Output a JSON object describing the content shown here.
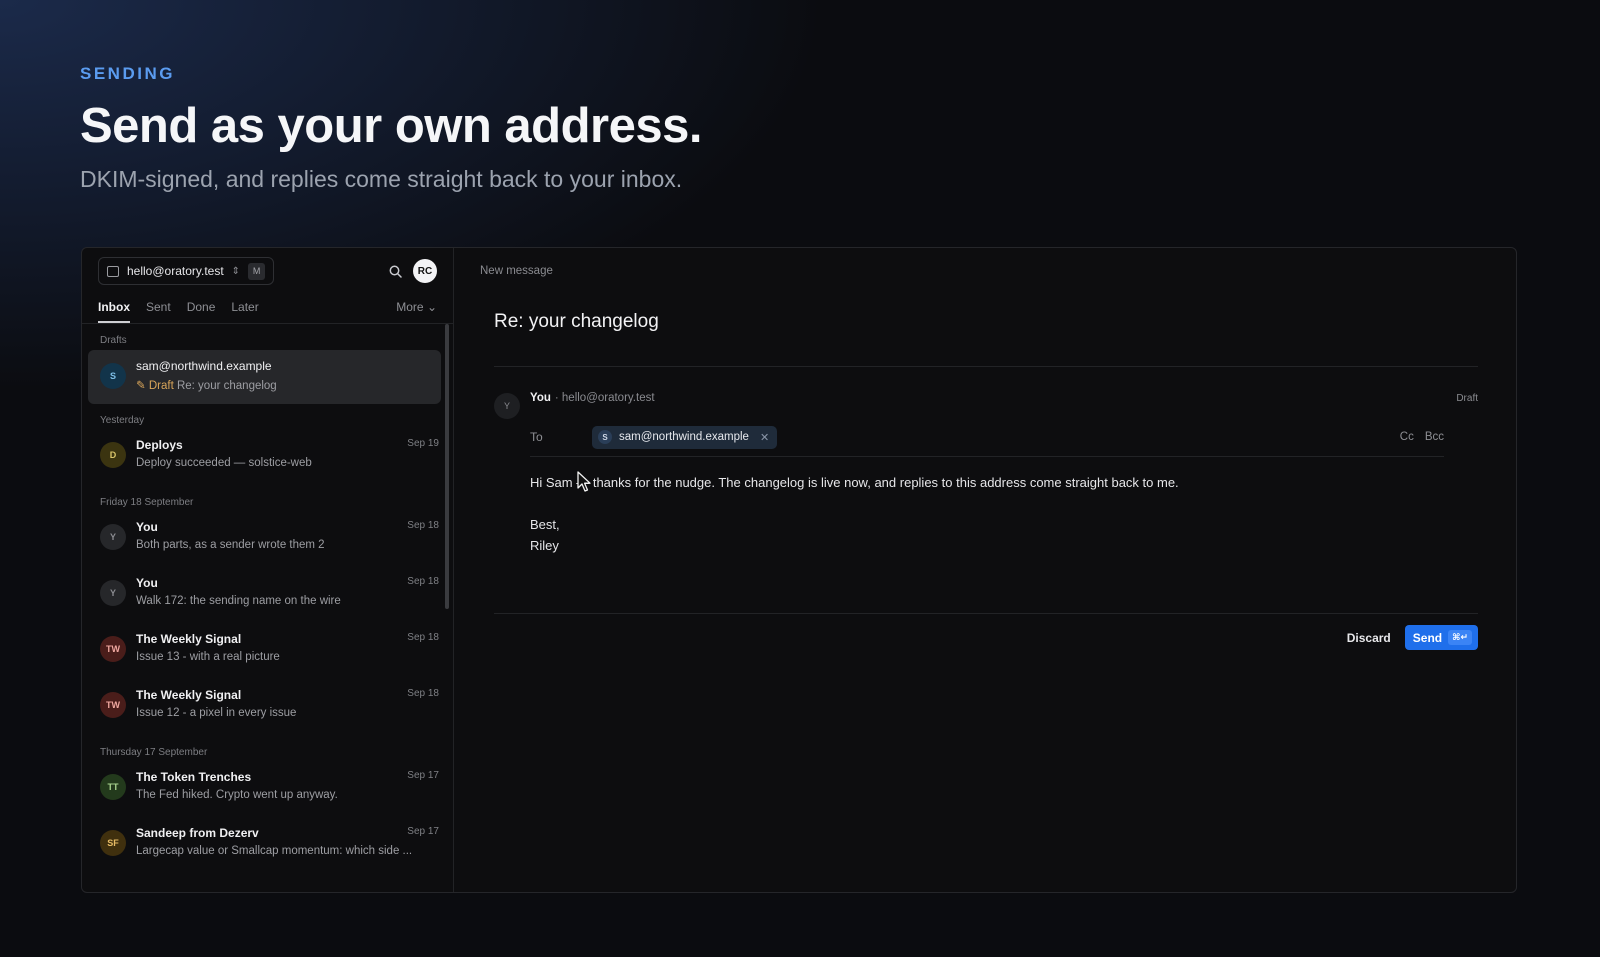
{
  "hero": {
    "eyebrow": "SENDING",
    "headline": "Send as your own address.",
    "subline": "DKIM-signed, and replies come straight back to your inbox."
  },
  "sidebar": {
    "account": "hello@oratory.test",
    "account_shortcut": "M",
    "user_initials": "RC",
    "tabs": [
      "Inbox",
      "Sent",
      "Done",
      "Later"
    ],
    "more_label": "More",
    "groups": [
      {
        "label": "Drafts",
        "items": [
          {
            "initial": "S",
            "from": "sam@northwind.example",
            "draft_label": "Draft",
            "snippet": "Re: your changelog",
            "date": ""
          }
        ]
      },
      {
        "label": "Yesterday",
        "items": [
          {
            "initial": "D",
            "from": "Deploys",
            "snippet": "Deploy succeeded — solstice-web",
            "date": "Sep 19"
          }
        ]
      },
      {
        "label": "Friday 18 September",
        "items": [
          {
            "initial": "Y",
            "from": "You",
            "snippet": "Both parts, as a sender wrote them  2",
            "date": "Sep 18"
          },
          {
            "initial": "Y",
            "from": "You",
            "snippet": "Walk 172: the sending name on the wire",
            "date": "Sep 18"
          },
          {
            "initial": "TW",
            "from": "The Weekly Signal",
            "snippet": "Issue 13 - with a real picture",
            "date": "Sep 18"
          },
          {
            "initial": "TW",
            "from": "The Weekly Signal",
            "snippet": "Issue 12 - a pixel in every issue",
            "date": "Sep 18"
          }
        ]
      },
      {
        "label": "Thursday 17 September",
        "items": [
          {
            "initial": "TT",
            "from": "The Token Trenches",
            "snippet": "The Fed hiked. Crypto went up anyway.",
            "date": "Sep 17"
          },
          {
            "initial": "SF",
            "from": "Sandeep from Dezerv",
            "snippet": "Largecap value or Smallcap momentum: which side ...",
            "date": "Sep 17"
          }
        ]
      }
    ]
  },
  "compose": {
    "window_title": "New message",
    "subject": "Re: your changelog",
    "from_initial": "Y",
    "from_name": "You",
    "from_address": "· hello@oratory.test",
    "status": "Draft",
    "to_label": "To",
    "recipient_initial": "S",
    "recipient": "sam@northwind.example",
    "cc_label": "Cc",
    "bcc_label": "Bcc",
    "body_line1": "Hi Sam — thanks for the nudge. The changelog is live now, and replies to this address come straight back to me.",
    "body_line2": "Best,",
    "body_line3": "Riley",
    "discard_label": "Discard",
    "send_label": "Send",
    "send_shortcut": "⌘↵"
  },
  "colors": {
    "accent": "#1f6feb",
    "eyebrow": "#5b9cf0",
    "draft": "#d9a55a"
  }
}
